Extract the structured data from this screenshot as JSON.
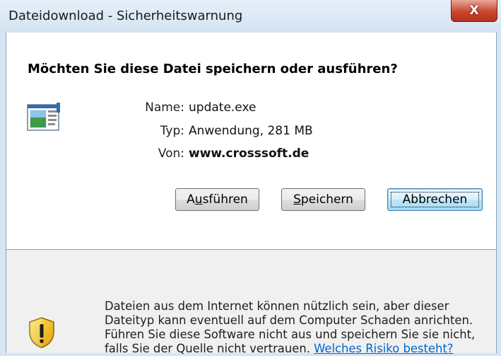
{
  "window": {
    "title": "Dateidownload - Sicherheitswarnung",
    "close_label": "X"
  },
  "dialog": {
    "question": "Möchten Sie diese Datei speichern oder ausführen?",
    "name_label": "Name:",
    "name_value": "update.exe",
    "type_label": "Typ:",
    "type_value": "Anwendung, 281 MB",
    "from_label": "Von:",
    "from_value": "www.crosssoft.de"
  },
  "buttons": {
    "run_pre": "A",
    "run_ul": "u",
    "run_post": "sführen",
    "save_pre": "",
    "save_ul": "S",
    "save_post": "peichern",
    "cancel": "Abbrechen"
  },
  "warning": {
    "text": "Dateien aus dem Internet können nützlich sein, aber dieser Dateityp kann eventuell auf dem Computer Schaden anrichten. Führen Sie diese Software nicht aus und speichern Sie sie nicht, falls Sie der Quelle nicht vertrauen.",
    "link": "Welches Risiko besteht?"
  },
  "icons": {
    "file": "application-file-icon",
    "shield": "security-shield-warning-icon",
    "close": "close-icon"
  },
  "colors": {
    "close_button": "#c8472f",
    "link": "#0066cc",
    "default_button_border": "#3c7fb1",
    "shield_yellow": "#f4c20d"
  }
}
